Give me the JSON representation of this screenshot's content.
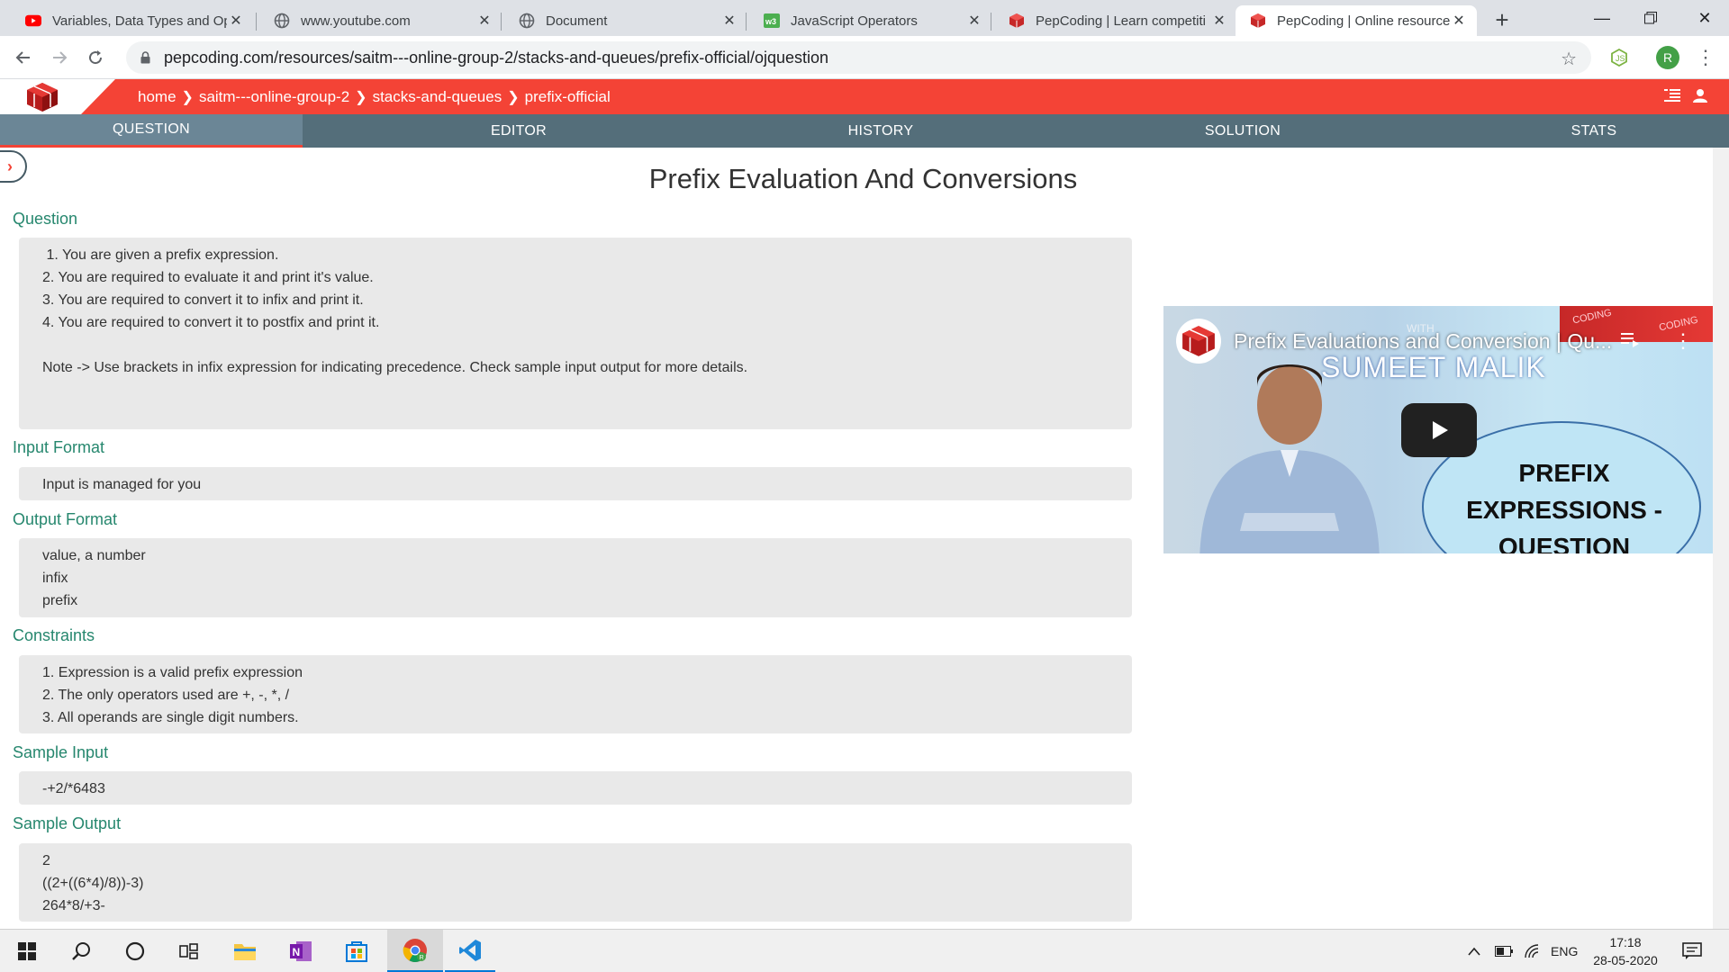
{
  "browser": {
    "tabs": [
      {
        "title": "Variables, Data Types and Op",
        "icon": "youtube-icon"
      },
      {
        "title": "www.youtube.com",
        "icon": "globe-icon"
      },
      {
        "title": "Document",
        "icon": "globe-icon"
      },
      {
        "title": "JavaScript Operators",
        "icon": "w3schools-icon"
      },
      {
        "title": "PepCoding | Learn competiti",
        "icon": "pepcoding-icon"
      },
      {
        "title": "PepCoding | Online resource",
        "icon": "pepcoding-icon"
      }
    ],
    "new_tab": "+",
    "url": "pepcoding.com/resources/saitm---online-group-2/stacks-and-queues/prefix-official/ojquestion",
    "profile_initial": "R"
  },
  "header": {
    "breadcrumbs": [
      "home",
      "saitm---online-group-2",
      "stacks-and-queues",
      "prefix-official"
    ],
    "brand_color": "#f44336"
  },
  "nav": {
    "tabs": [
      "QUESTION",
      "EDITOR",
      "HISTORY",
      "SOLUTION",
      "STATS"
    ],
    "active": "QUESTION"
  },
  "problem": {
    "title": "Prefix Evaluation And Conversions",
    "sections": {
      "question": {
        "label": "Question",
        "lines": [
          " 1. You are given a prefix expression.",
          "2. You are required to evaluate it and print it's value.",
          "3. You are required to convert it to infix and print it.",
          "4. You are required to convert it to postfix and print it.",
          "",
          "Note -> Use brackets in infix expression for indicating precedence. Check sample input output for more details."
        ]
      },
      "input_format": {
        "label": "Input Format",
        "lines": [
          "Input is managed for you"
        ]
      },
      "output_format": {
        "label": "Output Format",
        "lines": [
          "value, a number",
          "infix",
          "prefix"
        ]
      },
      "constraints": {
        "label": "Constraints",
        "lines": [
          "1. Expression is a valid prefix expression",
          "2. The only operators used are +, -, *, /",
          "3. All operands are single digit numbers."
        ]
      },
      "sample_input": {
        "label": "Sample Input",
        "lines": [
          "-+2/*6483"
        ]
      },
      "sample_output": {
        "label": "Sample Output",
        "lines": [
          "2",
          "((2+((6*4)/8))-3)",
          "264*8/+3-"
        ]
      }
    }
  },
  "video": {
    "title": "Prefix Evaluations and Conversion | Qu...",
    "overlay_small": "WITH",
    "overlay_name": "SUMEET MALIK",
    "overlay_topic": "PREFIX EXPRESSIONS - QUESTION",
    "corner_text": "CODING"
  },
  "taskbar": {
    "language": "ENG",
    "time": "17:18",
    "date": "28-05-2020"
  }
}
